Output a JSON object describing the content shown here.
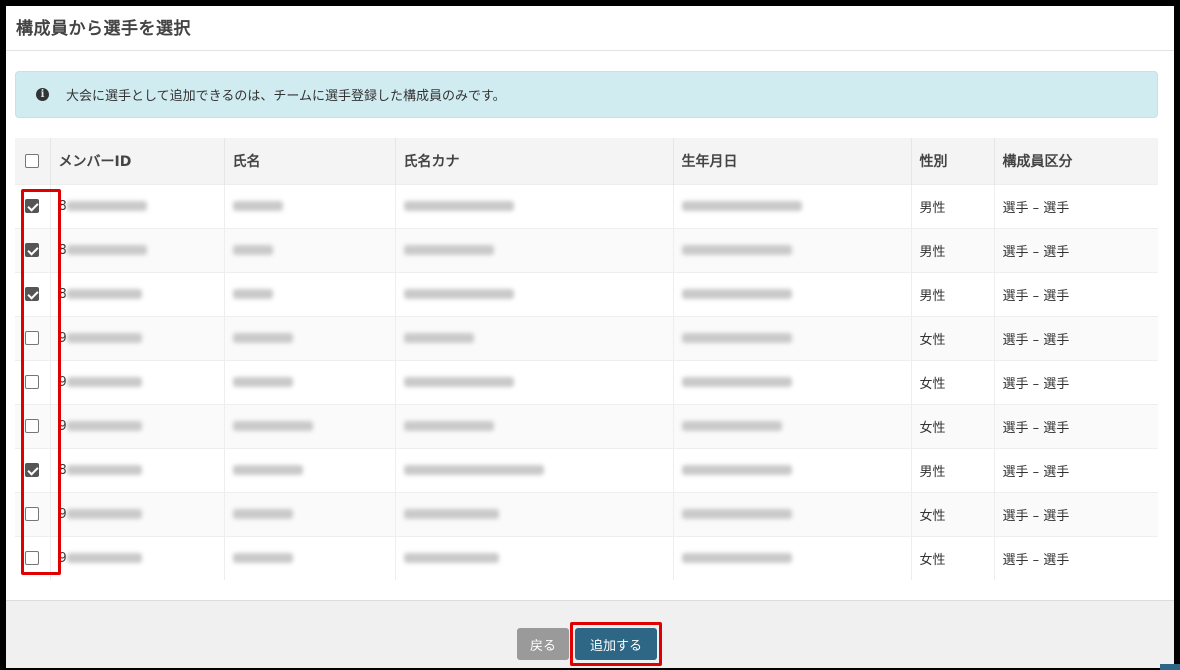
{
  "modal": {
    "title": "構成員から選手を選択"
  },
  "alert": {
    "icon": "info-icon",
    "text": "大会に選手として追加できるのは、チームに選手登録した構成員のみです。"
  },
  "table": {
    "columns": [
      "メンバーID",
      "氏名",
      "氏名カナ",
      "生年月日",
      "性別",
      "構成員区分"
    ],
    "rows": [
      {
        "checked": true,
        "id_prefix": "8",
        "gender": "男性",
        "category": "選手 – 選手"
      },
      {
        "checked": true,
        "id_prefix": "8",
        "gender": "男性",
        "category": "選手 – 選手"
      },
      {
        "checked": true,
        "id_prefix": "8",
        "gender": "男性",
        "category": "選手 – 選手"
      },
      {
        "checked": false,
        "id_prefix": "9",
        "gender": "女性",
        "category": "選手 – 選手"
      },
      {
        "checked": false,
        "id_prefix": "9",
        "gender": "女性",
        "category": "選手 – 選手"
      },
      {
        "checked": false,
        "id_prefix": "9",
        "gender": "女性",
        "category": "選手 – 選手"
      },
      {
        "checked": true,
        "id_prefix": "8",
        "gender": "男性",
        "category": "選手 – 選手"
      },
      {
        "checked": false,
        "id_prefix": "9",
        "gender": "女性",
        "category": "選手 – 選手"
      },
      {
        "checked": false,
        "id_prefix": "9",
        "gender": "女性",
        "category": "選手 – 選手"
      }
    ]
  },
  "footer": {
    "back_label": "戻る",
    "add_label": "追加する"
  },
  "colors": {
    "highlight": "#e00000",
    "primary": "#2e6785",
    "info_bg": "#d1ecf1"
  }
}
